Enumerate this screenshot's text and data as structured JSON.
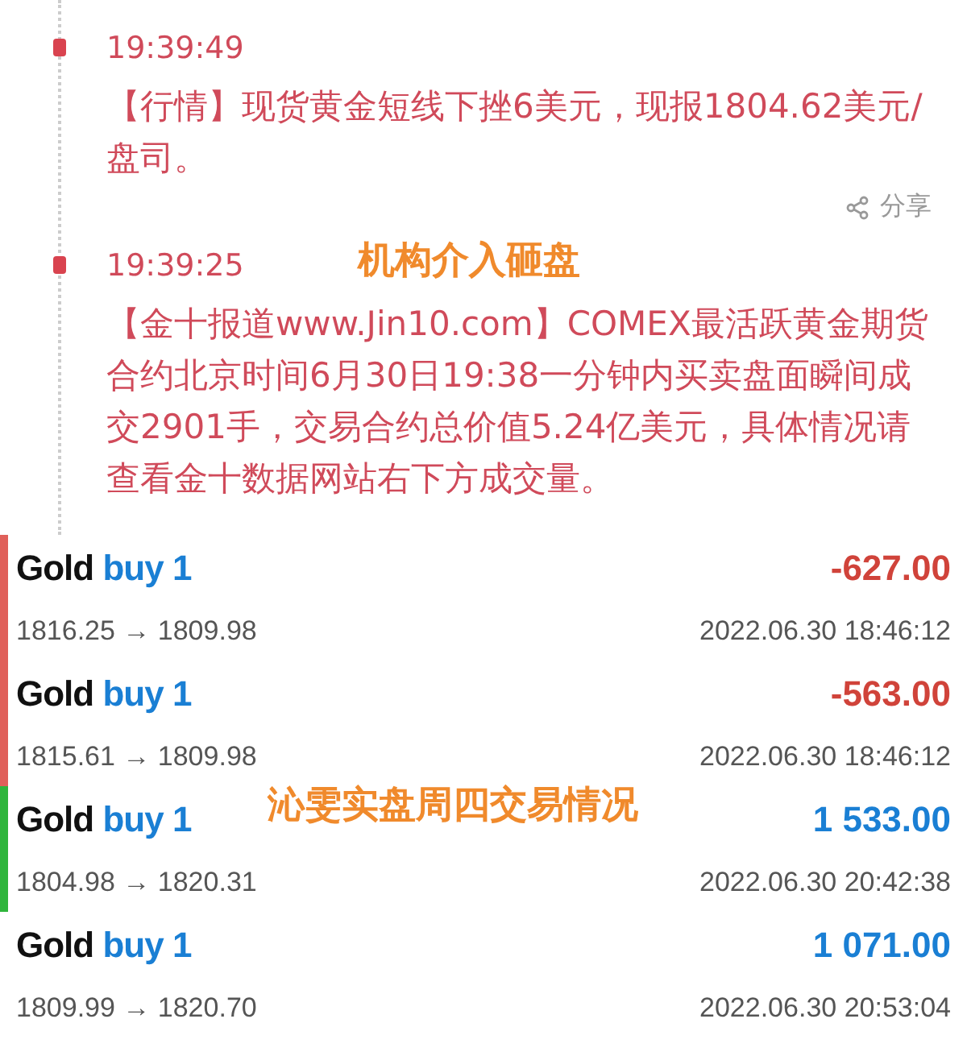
{
  "news": [
    {
      "time": "19:39:49",
      "text": "【行情】现货黄金短线下挫6美元，现报1804.62美元/盘司。",
      "share": "分享"
    },
    {
      "time": "19:39:25",
      "text": "【金十报道www.Jin10.com】COMEX最活跃黄金期货合约北京时间6月30日19:38一分钟内买卖盘面瞬间成交2901手，交易合约总价值5.24亿美元，具体情况请查看金十数据网站右下方成交量。"
    }
  ],
  "annotations": [
    "机构介入砸盘",
    "沁雯实盘周四交易情况"
  ],
  "trades": [
    {
      "symbol": "Gold",
      "side": "buy 1",
      "prices": "1816.25 → 1809.98",
      "profit": "-627.00",
      "kind": "loss",
      "time": "2022.06.30 18:46:12",
      "color": "#e0605a"
    },
    {
      "symbol": "Gold",
      "side": "buy 1",
      "prices": "1815.61 → 1809.98",
      "profit": "-563.00",
      "kind": "loss",
      "time": "2022.06.30 18:46:12",
      "color": "#e0605a"
    },
    {
      "symbol": "Gold",
      "side": "buy 1",
      "prices": "1804.98 → 1820.31",
      "profit": "1 533.00",
      "kind": "profit",
      "time": "2022.06.30 20:42:38",
      "color": "#2fb53c"
    },
    {
      "symbol": "Gold",
      "side": "buy 1",
      "prices": "1809.99 → 1820.70",
      "profit": "1 071.00",
      "kind": "profit",
      "time": "2022.06.30 20:53:04"
    }
  ]
}
